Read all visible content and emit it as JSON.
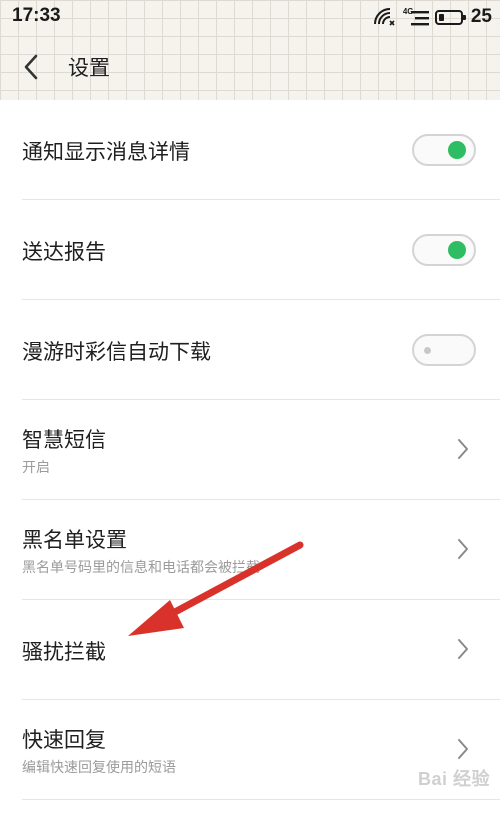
{
  "status_bar": {
    "time": "17:33",
    "network_label": "4G",
    "battery_text": "25",
    "battery_level": 0.25,
    "icons": [
      "wifi-icon",
      "signal-icon",
      "battery-icon"
    ]
  },
  "header": {
    "back_icon": "chevron-left-icon",
    "title": "设置"
  },
  "settings": {
    "items": [
      {
        "label": "通知显示消息详情",
        "control": "toggle",
        "on": true
      },
      {
        "label": "送达报告",
        "control": "toggle",
        "on": true
      },
      {
        "label": "漫游时彩信自动下载",
        "control": "toggle",
        "on": false
      },
      {
        "label": "智慧短信",
        "subtitle": "开启",
        "control": "chevron"
      },
      {
        "label": "黑名单设置",
        "subtitle": "黑名单号码里的信息和电话都会被拦截",
        "control": "chevron"
      },
      {
        "label": "骚扰拦截",
        "control": "chevron"
      },
      {
        "label": "快速回复",
        "subtitle": "编辑快速回复使用的短语",
        "control": "chevron"
      }
    ]
  },
  "colors": {
    "toggle_on": "#2ebd62",
    "toggle_off_knob": "#c8c8c8",
    "annotation_arrow": "#d9322a",
    "header_bg": "#f5f3ee"
  },
  "watermark": "Bai 经验"
}
